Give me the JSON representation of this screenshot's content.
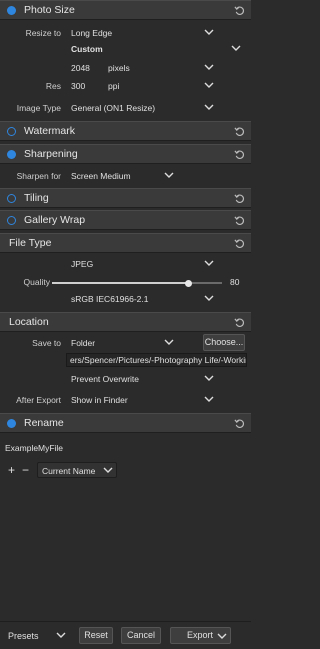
{
  "photo_size": {
    "title": "Photo Size",
    "resize_label": "Resize to",
    "resize_value": "Long Edge",
    "preset_value": "Custom",
    "size_value": "2048",
    "size_unit": "pixels",
    "res_label": "Res",
    "res_value": "300",
    "res_unit": "ppi",
    "image_type_label": "Image Type",
    "image_type_value": "General (ON1 Resize)"
  },
  "watermark": {
    "title": "Watermark"
  },
  "sharpening": {
    "title": "Sharpening",
    "sharpen_for_label": "Sharpen for",
    "sharpen_for_value": "Screen Medium"
  },
  "tiling": {
    "title": "Tiling"
  },
  "gallery_wrap": {
    "title": "Gallery Wrap"
  },
  "file_type": {
    "title": "File Type",
    "format_value": "JPEG",
    "quality_label": "Quality",
    "quality_value": "80",
    "quality_fraction": 0.8,
    "color_profile_value": "sRGB IEC61966-2.1"
  },
  "location": {
    "title": "Location",
    "save_to_label": "Save to",
    "save_to_value": "Folder",
    "choose_label": "Choose...",
    "path_value": "ers/Spencer/Pictures/-Photography Life/-Working",
    "overwrite_value": "Prevent Overwrite",
    "after_export_label": "After Export",
    "after_export_value": "Show in Finder"
  },
  "rename": {
    "title": "Rename",
    "example_label": "Example",
    "example_value": "MyFile",
    "plus_label": "+",
    "minus_label": "−",
    "token_value": "Current Name"
  },
  "footer": {
    "presets_label": "Presets",
    "reset_label": "Reset",
    "cancel_label": "Cancel",
    "export_label": "Export"
  },
  "colors": {
    "accent": "#2f86df",
    "panel": "#2b2b2b",
    "header": "#3a3a3a"
  }
}
